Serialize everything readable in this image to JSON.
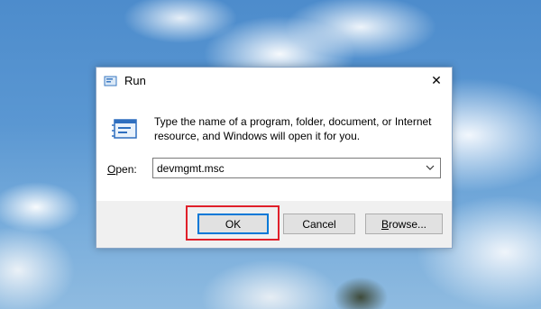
{
  "window": {
    "title": "Run",
    "close_glyph": "✕",
    "description": "Type the name of a program, folder, document, or Internet resource, and Windows will open it for you."
  },
  "open": {
    "label_prefix": "O",
    "label_rest": "pen:",
    "value": "devmgmt.msc"
  },
  "buttons": {
    "ok": "OK",
    "cancel": "Cancel",
    "browse_prefix": "B",
    "browse_rest": "rowse..."
  },
  "icons": {
    "title": "run-icon",
    "main": "run-icon",
    "close": "close-icon",
    "dropdown": "chevron-down-icon"
  },
  "colors": {
    "highlight": "#e0202a",
    "focus_border": "#0078d7",
    "footer_bg": "#f0f0f0"
  }
}
